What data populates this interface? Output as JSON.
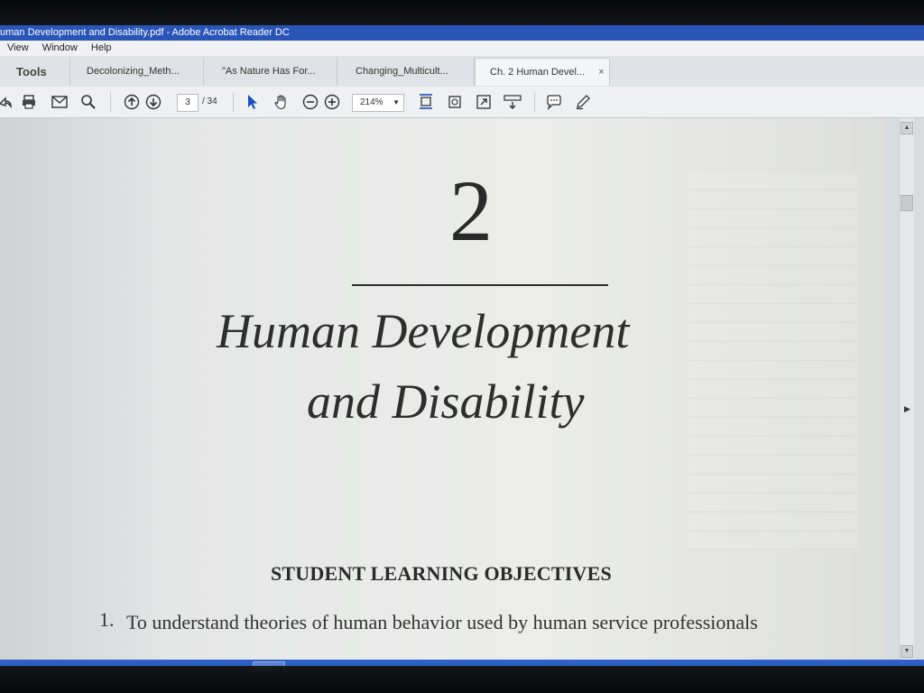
{
  "window": {
    "title": "uman Development and Disability.pdf - Adobe Acrobat Reader DC"
  },
  "menu": [
    "View",
    "Window",
    "Help"
  ],
  "tabs": [
    {
      "label": "Tools"
    },
    {
      "label": "Decolonizing_Meth..."
    },
    {
      "label": "\"As Nature Has For..."
    },
    {
      "label": "Changing_Multicult..."
    },
    {
      "label": "Ch. 2 Human Devel...",
      "active": true,
      "close": "×"
    }
  ],
  "toolbar": {
    "page_current": "3",
    "page_total": "/ 34",
    "zoom": "214%"
  },
  "document": {
    "chapter_number": "2",
    "title_line1": "Human Development",
    "title_line2": "and Disability",
    "section_heading": "STUDENT LEARNING OBJECTIVES",
    "objective_number": "1.",
    "objective_text": "To understand theories of human behavior used by human service professionals"
  },
  "taskbar": {
    "apps": [
      "internet-explorer",
      "file-explorer",
      "media-player",
      "chrome",
      "sticky-folder",
      "word",
      "acrobat-reader"
    ]
  },
  "colors": {
    "titlebar": "#2a55b8",
    "taskbar": "#2f62c9",
    "acrobat_red": "#c0201e"
  }
}
